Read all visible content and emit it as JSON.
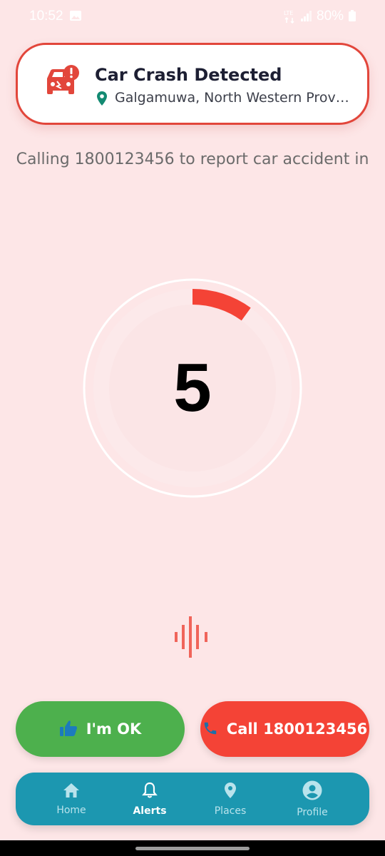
{
  "status_bar": {
    "time": "10:52",
    "battery": "80%"
  },
  "alert": {
    "title": "Car Crash Detected",
    "location": "Galgamuwa, North Western Province, Sri Lanka"
  },
  "calling_text": "Calling 1800123456 to report car accident in",
  "countdown": {
    "value": "5",
    "progress_fraction": 0.1,
    "accent": "#f44336"
  },
  "buttons": {
    "ok_label": "I'm OK",
    "call_label": "Call 1800123456"
  },
  "bottom_nav": {
    "items": [
      {
        "label": "Home",
        "icon": "home-icon"
      },
      {
        "label": "Alerts",
        "icon": "bell-icon",
        "active": true
      },
      {
        "label": "Places",
        "icon": "location-pin-icon"
      },
      {
        "label": "Profile",
        "icon": "account-circle-icon"
      }
    ]
  },
  "colors": {
    "background": "#fde6e7",
    "alert_red": "#e2463b",
    "ok_green": "#4db04d",
    "nav_teal": "#1c97b0"
  }
}
